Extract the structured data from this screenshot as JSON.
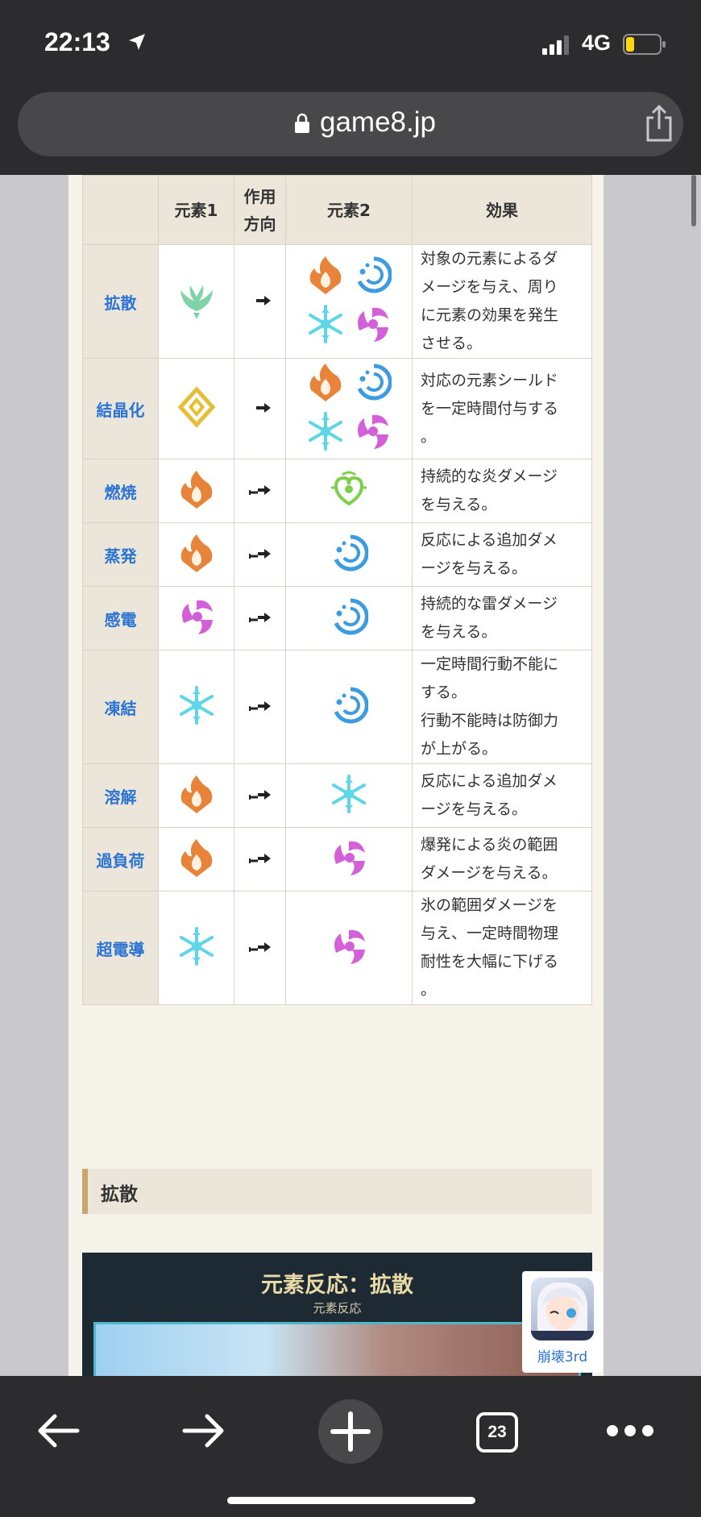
{
  "status_bar": {
    "time": "22:13",
    "network": "4G"
  },
  "browser": {
    "url": "game8.jp",
    "tab_count": "23"
  },
  "table": {
    "headers": {
      "element1": "元素1",
      "direction_line1": "作用",
      "direction_line2": "方向",
      "element2": "元素2",
      "effect": "効果"
    },
    "rows": [
      {
        "name": "拡散",
        "element1": "anemo",
        "element2": [
          "pyro",
          "hydro",
          "cryo",
          "electro"
        ],
        "effect_lines": [
          "対象の元素によるダ",
          "メージを与え、周り",
          "に元素の効果を発生",
          "させる。"
        ]
      },
      {
        "name": "結晶化",
        "element1": "geo",
        "element2": [
          "pyro",
          "hydro",
          "cryo",
          "electro"
        ],
        "effect_lines": [
          "対応の元素シールド",
          "を一定時間付与する",
          "。"
        ]
      },
      {
        "name": "燃焼",
        "element1": "pyro",
        "element2": [
          "dendro"
        ],
        "effect_lines": [
          "持続的な炎ダメージ",
          "を与える。"
        ]
      },
      {
        "name": "蒸発",
        "element1": "pyro",
        "element2": [
          "hydro"
        ],
        "effect_lines": [
          "反応による追加ダメ",
          "ージを与える。"
        ]
      },
      {
        "name": "感電",
        "element1": "electro",
        "element2": [
          "hydro"
        ],
        "effect_lines": [
          "持続的な雷ダメージ",
          "を与える。"
        ]
      },
      {
        "name": "凍結",
        "element1": "cryo",
        "element2": [
          "hydro"
        ],
        "effect_lines": [
          "一定時間行動不能に",
          "する。",
          "行動不能時は防御力",
          "が上がる。"
        ]
      },
      {
        "name": "溶解",
        "element1": "pyro",
        "element2": [
          "cryo"
        ],
        "effect_lines": [
          "反応による追加ダメ",
          "ージを与える。"
        ]
      },
      {
        "name": "過負荷",
        "element1": "pyro",
        "element2": [
          "electro"
        ],
        "effect_lines": [
          "爆発による炎の範囲",
          "ダメージを与える。"
        ]
      },
      {
        "name": "超電導",
        "element1": "cryo",
        "element2": [
          "electro"
        ],
        "effect_lines": [
          "氷の範囲ダメージを",
          "与え、一定時間物理",
          "耐性を大幅に下げる",
          "。"
        ]
      }
    ]
  },
  "section_heading": "拡散",
  "banner": {
    "title": "元素反応：拡散",
    "subtitle": "元素反応"
  },
  "ad": {
    "label": "崩壊3rd"
  },
  "colors": {
    "link_blue": "#2b74d3",
    "header_bg": "#ebe6d9",
    "pyro": "#e8843a",
    "hydro": "#3d9be0",
    "cryo": "#5fd6e8",
    "electro": "#d35fd9",
    "anemo": "#7fd3a6",
    "geo": "#e6be35",
    "dendro": "#7ed04a"
  }
}
